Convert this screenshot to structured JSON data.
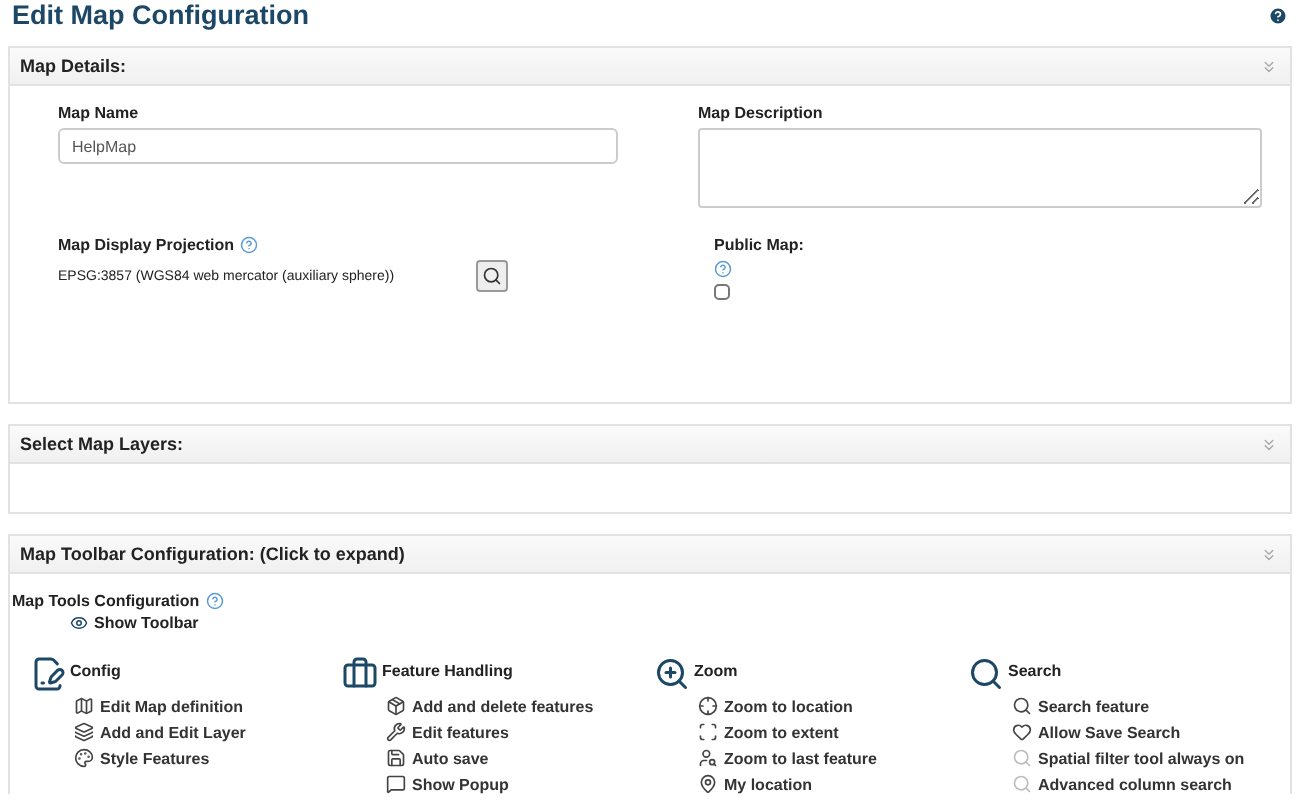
{
  "page_title": "Edit Map Configuration",
  "map_details": {
    "header": "Map Details:",
    "map_name_label": "Map Name",
    "map_name_value": "HelpMap",
    "description_label": "Map Description",
    "projection_label": "Map Display Projection",
    "projection_value": "EPSG:3857 (WGS84 web mercator (auxiliary sphere))",
    "public_label": "Public Map:",
    "public_checked": false
  },
  "layers": {
    "header": "Select Map Layers:"
  },
  "toolbar": {
    "header": "Map Toolbar Configuration: (Click to expand)",
    "tools_label": "Map Tools Configuration",
    "show_toolbar": "Show Toolbar",
    "groups": [
      {
        "kind": "config",
        "title": "Config",
        "items": [
          {
            "kind": "map",
            "label": "Edit Map definition",
            "enabled": true
          },
          {
            "kind": "layers",
            "label": "Add and Edit Layer",
            "enabled": true
          },
          {
            "kind": "palette",
            "label": "Style Features",
            "enabled": true
          }
        ]
      },
      {
        "kind": "briefcase",
        "title": "Feature Handling",
        "items": [
          {
            "kind": "box",
            "label": "Add and delete features",
            "enabled": true
          },
          {
            "kind": "wrench",
            "label": "Edit features",
            "enabled": true
          },
          {
            "kind": "save",
            "label": "Auto save",
            "enabled": true
          },
          {
            "kind": "popup",
            "label": "Show Popup",
            "enabled": true
          }
        ]
      },
      {
        "kind": "zoom",
        "title": "Zoom",
        "items": [
          {
            "kind": "target",
            "label": "Zoom to location",
            "enabled": true
          },
          {
            "kind": "extent",
            "label": "Zoom to extent",
            "enabled": true
          },
          {
            "kind": "person",
            "label": "Zoom to last feature",
            "enabled": true
          },
          {
            "kind": "pin",
            "label": "My location",
            "enabled": true
          }
        ]
      },
      {
        "kind": "search",
        "title": "Search",
        "items": [
          {
            "kind": "search",
            "label": "Search feature",
            "enabled": true
          },
          {
            "kind": "heart",
            "label": "Allow Save Search",
            "enabled": true
          },
          {
            "kind": "search",
            "label": "Spatial filter tool always on",
            "enabled": false
          },
          {
            "kind": "search",
            "label": "Advanced column search",
            "enabled": false
          }
        ]
      }
    ]
  }
}
